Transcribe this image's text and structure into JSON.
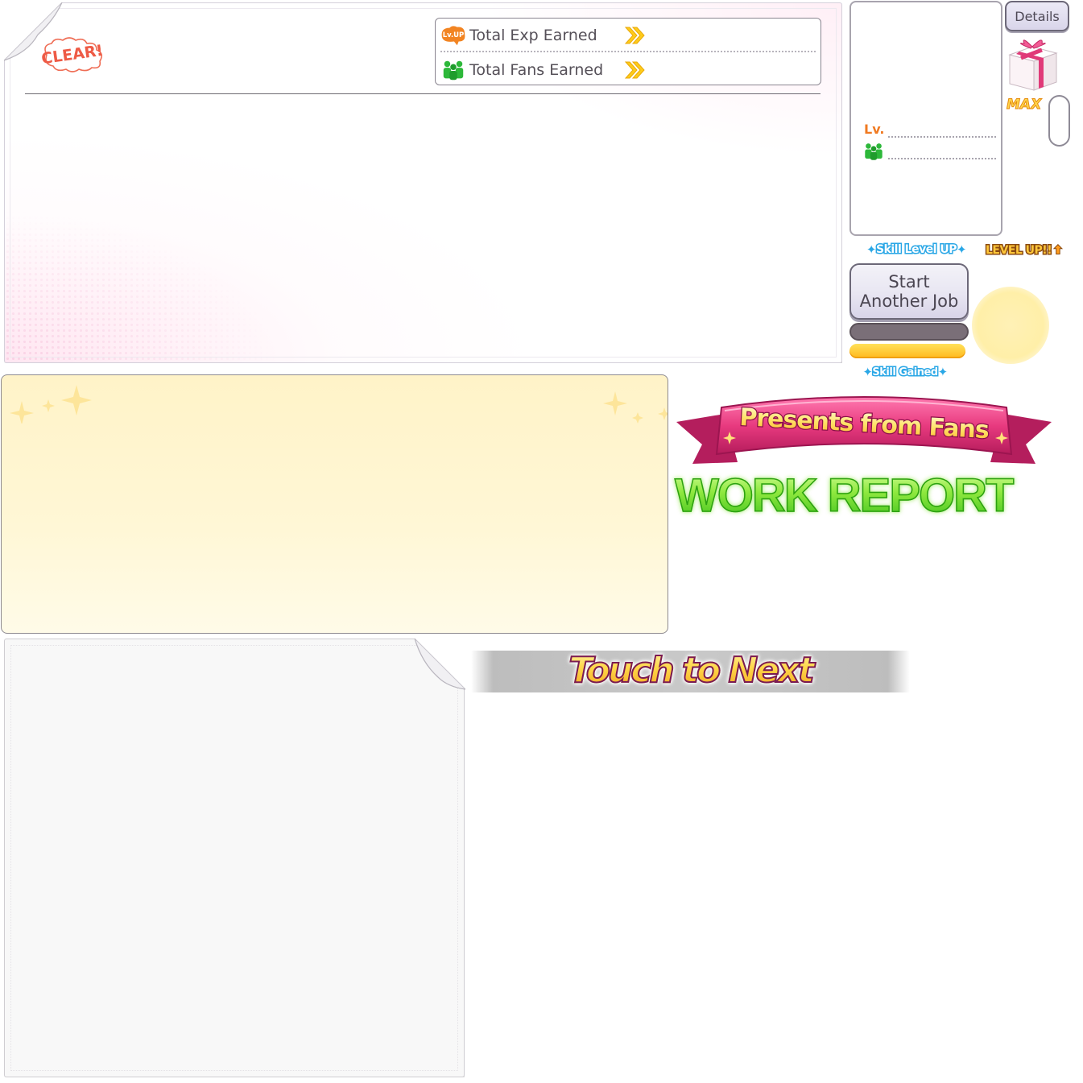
{
  "result_sheet": {
    "clear_stamp": "CLEAR!",
    "stats": [
      {
        "icon": "lv-up-icon",
        "icon_text": "Lv.UP",
        "label": "Total Exp Earned"
      },
      {
        "icon": "fans-icon",
        "label": "Total Fans Earned"
      }
    ]
  },
  "profile_card": {
    "level_label": "Lv.",
    "fans_icon": "fans-icon"
  },
  "details_button": {
    "label": "Details"
  },
  "gift": {
    "icon": "gift-box-icon",
    "max_label": "MAX"
  },
  "badges": {
    "skill_level_up": "Skill Level UP",
    "level_up": "LEVEL UP!!",
    "skill_gained": "Skill Gained"
  },
  "start_job_button": {
    "line1": "Start",
    "line2": "Another Job"
  },
  "banners": {
    "presents_from_fans": "Presents from Fans",
    "work_report": "WORK REPORT",
    "touch_to_next": "Touch to Next"
  },
  "colors": {
    "exp_orange": "#f07a22",
    "fans_green": "#2db83a",
    "chevron_yellow": "#ffcc1a",
    "skill_blue": "#2aa7e6",
    "ribbon_pink": "#e0357a",
    "work_report_green": "#6bd82c",
    "panel_yellow": "#fff3c8"
  }
}
